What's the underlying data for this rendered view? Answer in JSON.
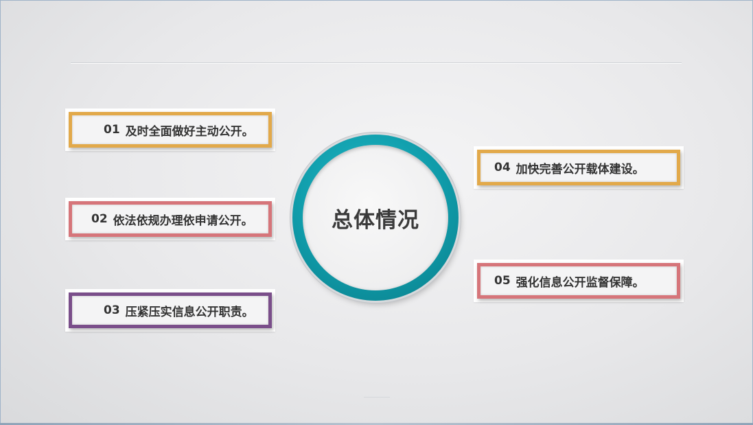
{
  "center": {
    "title": "总体情况",
    "ring_color": "#0f9aa8"
  },
  "items": [
    {
      "num": "01",
      "text": "及时全面做好主动公开。",
      "color": "#e2a94a"
    },
    {
      "num": "02",
      "text": "依法依规办理依申请公开。",
      "color": "#d6757a"
    },
    {
      "num": "03",
      "text": "压紧压实信息公开职责。",
      "color": "#7a4e8a"
    },
    {
      "num": "04",
      "text": "加快完善公开载体建设。",
      "color": "#e2a94a"
    },
    {
      "num": "05",
      "text": "强化信息公开监督保障。",
      "color": "#d6757a"
    }
  ]
}
